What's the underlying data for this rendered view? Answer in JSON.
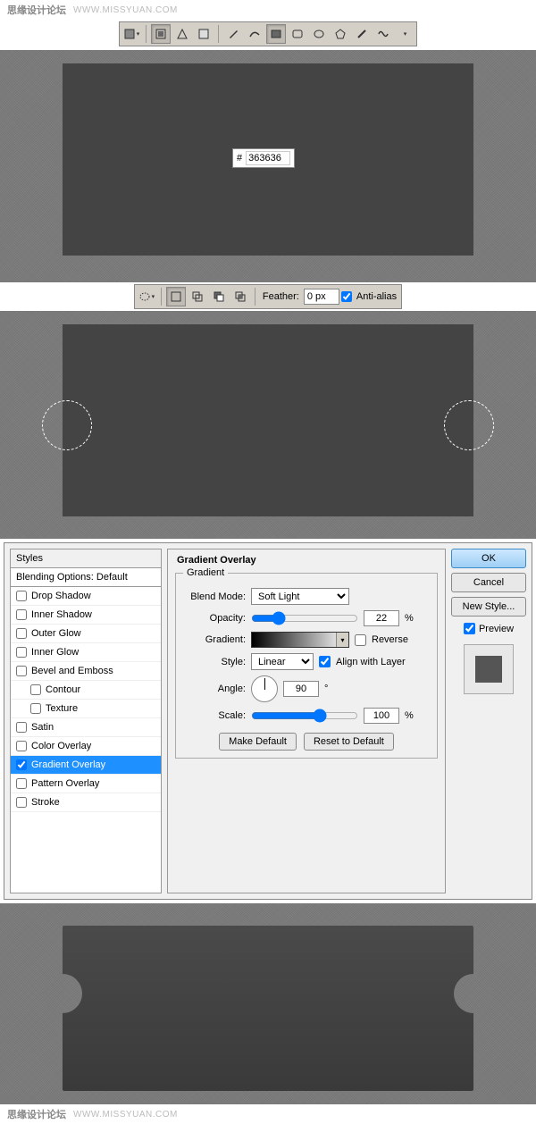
{
  "watermark": {
    "cn": "思缘设计论坛",
    "url": "WWW.MISSYUAN.COM"
  },
  "toolbar1": {
    "shape_dd": "▾",
    "shape2_dd": "▾"
  },
  "canvas1": {
    "color_hash": "#",
    "color_hex": "363636"
  },
  "toolbar2": {
    "feather_label": "Feather:",
    "feather_value": "0 px",
    "antialias_label": "Anti-alias"
  },
  "dialog": {
    "styles_header": "Styles",
    "blending_options": "Blending Options: Default",
    "items": [
      {
        "label": "Drop Shadow",
        "checked": false
      },
      {
        "label": "Inner Shadow",
        "checked": false
      },
      {
        "label": "Outer Glow",
        "checked": false
      },
      {
        "label": "Inner Glow",
        "checked": false
      },
      {
        "label": "Bevel and Emboss",
        "checked": false
      },
      {
        "label": "Contour",
        "checked": false,
        "indent": true
      },
      {
        "label": "Texture",
        "checked": false,
        "indent": true
      },
      {
        "label": "Satin",
        "checked": false
      },
      {
        "label": "Color Overlay",
        "checked": false
      },
      {
        "label": "Gradient Overlay",
        "checked": true,
        "selected": true
      },
      {
        "label": "Pattern Overlay",
        "checked": false
      },
      {
        "label": "Stroke",
        "checked": false
      }
    ],
    "panel_title": "Gradient Overlay",
    "group_title": "Gradient",
    "blend_mode_label": "Blend Mode:",
    "blend_mode_value": "Soft Light",
    "opacity_label": "Opacity:",
    "opacity_value": "22",
    "pct": "%",
    "gradient_label": "Gradient:",
    "reverse_label": "Reverse",
    "style_label": "Style:",
    "style_value": "Linear",
    "align_label": "Align with Layer",
    "angle_label": "Angle:",
    "angle_value": "90",
    "deg": "°",
    "scale_label": "Scale:",
    "scale_value": "100",
    "make_default": "Make Default",
    "reset_default": "Reset to Default",
    "ok": "OK",
    "cancel": "Cancel",
    "new_style": "New Style...",
    "preview": "Preview"
  }
}
